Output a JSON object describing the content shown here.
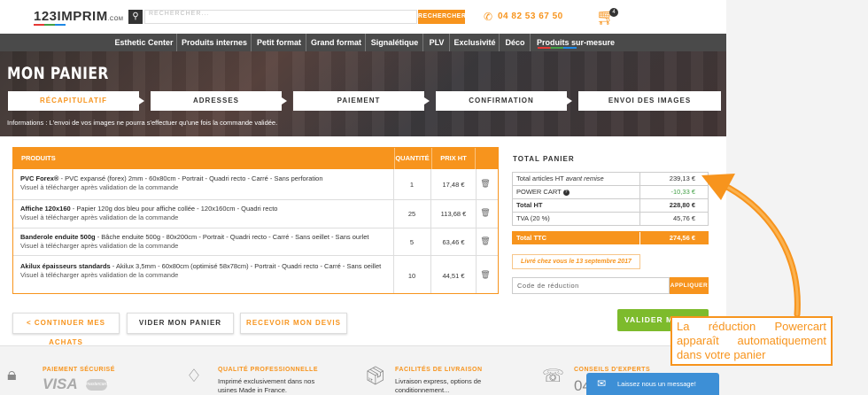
{
  "header": {
    "logo": "123IMPRIM",
    "logo_suffix": ".COM",
    "search_placeholder": "RECHERCHER...",
    "search_button": "RECHERCHER",
    "phone": "04 82 53 67 50",
    "cart_count": "4"
  },
  "nav": [
    "Esthetic Center",
    "Produits internes",
    "Petit format",
    "Grand format",
    "Signalétique",
    "PLV",
    "Exclusivité",
    "Déco",
    "Produits sur-mesure"
  ],
  "page_title": "MON PANIER",
  "steps": [
    "RÉCAPITULATIF",
    "ADRESSES",
    "PAIEMENT",
    "CONFIRMATION",
    "ENVOI DES IMAGES"
  ],
  "info_text": "Informations : L'envoi de vos images ne pourra s'effectuer qu'une fois la commande validée.",
  "table": {
    "headers": [
      "PRODUITS",
      "QUANTITÉ",
      "PRIX HT"
    ],
    "rows": [
      {
        "name": "PVC Forex®",
        "desc": " - PVC expansé (forex) 2mm - 60x80cm - Portrait - Quadri recto - Carré - Sans perforation",
        "note": "Visuel à télécharger après validation de la commande",
        "qty": "1",
        "price": "17,48 €"
      },
      {
        "name": "Affiche 120x160",
        "desc": " - Papier 120g dos bleu pour affiche collée - 120x160cm - Quadri recto",
        "note": "Visuel à télécharger après validation de la commande",
        "qty": "25",
        "price": "113,68 €"
      },
      {
        "name": "Banderole enduite 500g",
        "desc": " - Bâche enduite 500g - 80x200cm - Portrait - Quadri recto - Carré - Sans oeillet - Sans ourlet",
        "note": "Visuel à télécharger après validation de la commande",
        "qty": "5",
        "price": "63,46 €"
      },
      {
        "name": "Akilux épaisseurs standards",
        "desc": " - Akilux 3,5mm - 60x80cm (optimisé 58x78cm) - Portrait - Quadri recto - Carré - Sans oeillet",
        "note": "Visuel à télécharger après validation de la commande",
        "qty": "10",
        "price": "44,51 €"
      }
    ]
  },
  "summary": {
    "title": "TOTAL PANIER",
    "rows": [
      {
        "label": "Total articles HT",
        "label_em": "avant remise",
        "value": "239,13 €"
      },
      {
        "label": "POWER CART",
        "value": "-10,33 €"
      },
      {
        "label": "Total HT",
        "value": "228,80 €"
      },
      {
        "label": "TVA (20 %)",
        "value": "45,76 €"
      },
      {
        "label": "Total TTC",
        "value": "274,56 €"
      }
    ],
    "delivery": "Livré chez vous le 13 septembre 2017",
    "promo_placeholder": "Code de réduction",
    "promo_button": "APPLIQUER"
  },
  "buttons": {
    "continue": "< CONTINUER MES ACHATS",
    "empty": "VIDER MON PANIER",
    "quote": "RECEVOIR MON DEVIS",
    "validate": "VALIDER MON"
  },
  "footer": {
    "features": [
      {
        "title": "PAIEMENT SÉCURISÉ",
        "text": ""
      },
      {
        "title": "QUALITÉ PROFESSIONNELLE",
        "text": "Imprimé exclusivement dans nos usines Made in France."
      },
      {
        "title": "FACILITÉS DE LIVRAISON",
        "text": "Livraison express, options de conditionnement..."
      },
      {
        "title": "CONSEILS D'EXPERTS",
        "text": ""
      }
    ],
    "visa": "VISA",
    "phone_partial": "04",
    "chat": "Laissez nous un message!"
  },
  "callout": "La réduction Powercart apparaît automatiquement dans votre panier",
  "colors": {
    "accent": "#f7941d",
    "green": "#7dbb2c",
    "dark_nav": "#4a4a4a",
    "chat_blue": "#3d8fd6"
  }
}
